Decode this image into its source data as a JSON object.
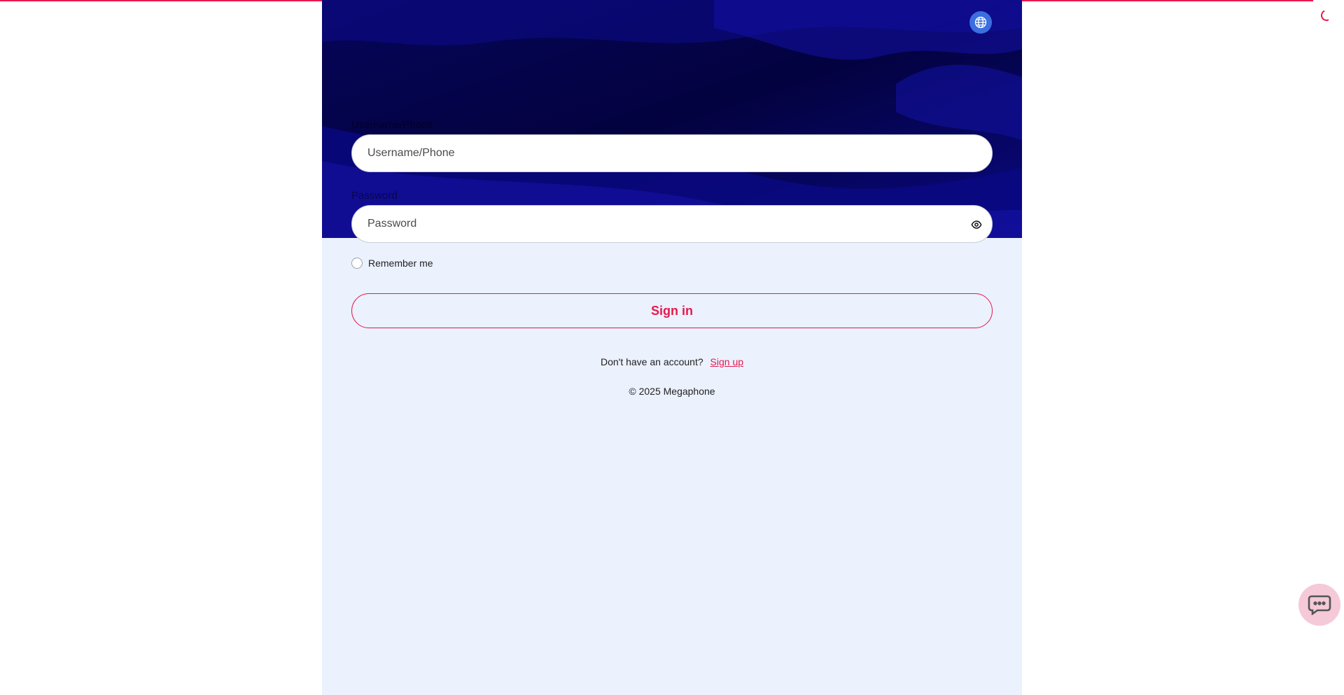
{
  "header": {
    "language_icon": "globe-icon",
    "accent_color": "#e5194f",
    "hero_color": "#0b0a7a"
  },
  "form": {
    "username": {
      "label": "Username/Phone",
      "placeholder": "Username/Phone",
      "value": ""
    },
    "password": {
      "label": "Password",
      "placeholder": "Password",
      "value": "",
      "toggle_icon": "eye-icon"
    },
    "remember_label": "Remember me",
    "submit_label": "Sign in"
  },
  "footer": {
    "signup_prompt": "Don't have an account?",
    "signup_link": "Sign up",
    "copyright": "© 2025 Megaphone"
  },
  "widgets": {
    "chat_icon": "chat-bubble-icon",
    "loading_icon": "spinner-icon"
  }
}
